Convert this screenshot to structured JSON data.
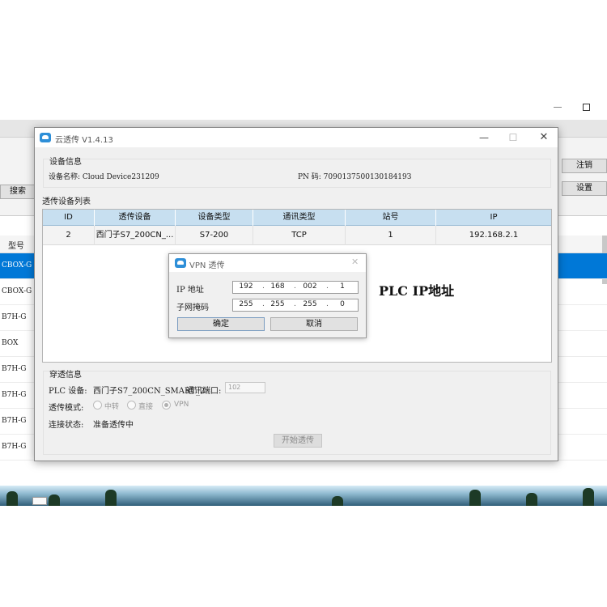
{
  "background": {
    "search_label": "搜索",
    "logout_label": "注销",
    "settings_label": "设置",
    "list_header": "型号",
    "rows": [
      "CBOX-G",
      "CBOX-G",
      "B7H-G",
      "BOX",
      "B7H-G",
      "B7H-G",
      "B7H-G",
      "B7H-G"
    ],
    "selected_row": 0
  },
  "main_dialog": {
    "title": "云透传 V1.4.13",
    "device_info": {
      "group_title": "设备信息",
      "name_label": "设备名称: Cloud Device231209",
      "pn_label": "PN 码: 709013750013018419З"
    },
    "device_list": {
      "title": "透传设备列表",
      "columns": [
        "ID",
        "透传设备",
        "设备类型",
        "通讯类型",
        "站号",
        "IP"
      ],
      "rows": [
        [
          "2",
          "西门子S7_200CN_...",
          "S7-200",
          "TCP",
          "1",
          "192.168.2.1"
        ]
      ]
    },
    "passthrough": {
      "group_title": "穿透信息",
      "plc_device_label": "PLC 设备:",
      "plc_device_value": "西门子S7_200CN_SMART_2",
      "port_label": "通讯端口:",
      "port_value": "102",
      "mode_label": "透传模式:",
      "modes": [
        "中转",
        "直接",
        "VPN"
      ],
      "selected_mode": 2,
      "status_label": "连接状态:",
      "status_value": "准备透传中",
      "start_button": "开始透传"
    }
  },
  "vpn_dialog": {
    "title": "VPN 透传",
    "ip_label": "IP 地址",
    "ip": [
      "192",
      "168",
      "002",
      "1"
    ],
    "mask_label": "子网掩码",
    "mask": [
      "255",
      "255",
      "255",
      "0"
    ],
    "ok_button": "确定",
    "cancel_button": "取消"
  },
  "annotation": "PLC IP地址",
  "colors": {
    "selection": "#0078d7",
    "table_header": "#c7dff0",
    "app_icon": "#2e8fd8"
  }
}
